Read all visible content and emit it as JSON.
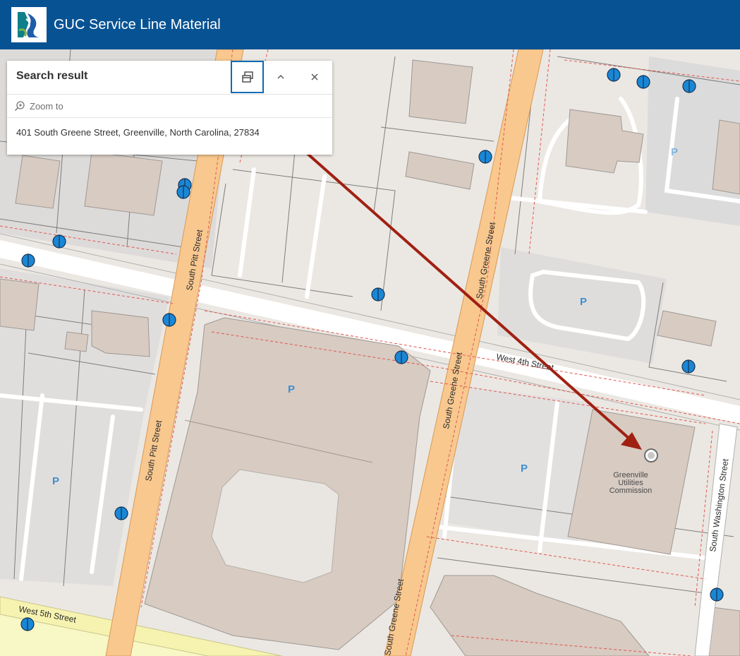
{
  "header": {
    "title": "GUC Service Line Material",
    "logo_icon": "guc-logo-icon",
    "background": "#075293"
  },
  "search_panel": {
    "title": "Search result",
    "dock_icon": "dock-icon",
    "collapse_icon": "chevron-up-icon",
    "close_icon": "close-icon",
    "zoom_to_label": "Zoom to",
    "result_text": "401 South Greene Street, Greenville, North Carolina, 27834"
  },
  "map": {
    "streets": {
      "south_pitt_1": "South Pitt Street",
      "south_pitt_2": "South Pitt Street",
      "south_greene_1": "South Greene Street",
      "south_greene_2": "South Greene Street",
      "south_greene_3": "South Greene Street",
      "west_4th": "West 4th Street",
      "west_5th": "West 5th Street",
      "south_washington": "South Washington Street"
    },
    "parking_label": "P",
    "building_label": [
      "Greenville",
      "Utilities",
      "Commission"
    ],
    "annotation_color": "#a02012",
    "marker_color": "#1a87d6"
  }
}
